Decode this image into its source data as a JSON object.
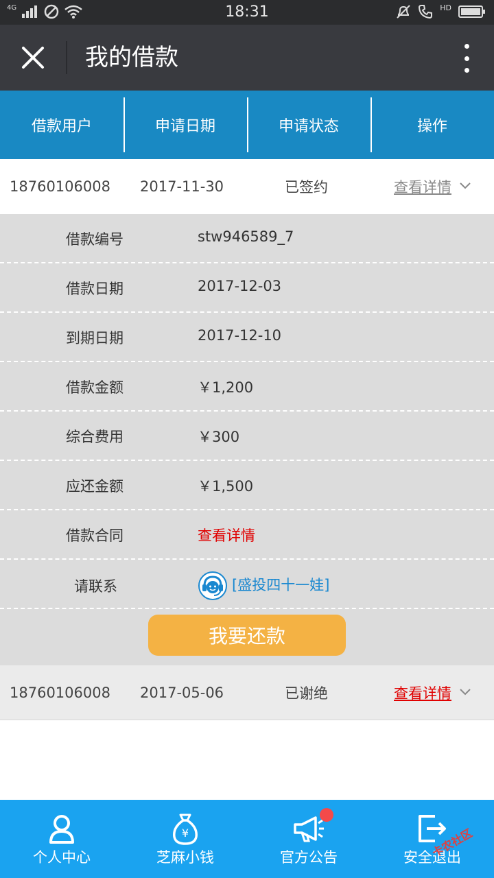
{
  "status_bar": {
    "network": "4G",
    "time": "18:31",
    "hd": "HD"
  },
  "title_bar": {
    "title": "我的借款"
  },
  "table_header": [
    "借款用户",
    "申请日期",
    "申请状态",
    "操作"
  ],
  "loans": [
    {
      "user": "18760106008",
      "date": "2017-11-30",
      "status": "已签约",
      "action": "查看详情"
    },
    {
      "user": "18760106008",
      "date": "2017-05-06",
      "status": "已谢绝",
      "action": "查看详情"
    }
  ],
  "details": {
    "loan_no": {
      "label": "借款编号",
      "value": "stw946589_7"
    },
    "loan_date": {
      "label": "借款日期",
      "value": "2017-12-03"
    },
    "due_date": {
      "label": "到期日期",
      "value": "2017-12-10"
    },
    "amount": {
      "label": "借款金额",
      "value": "￥1,200"
    },
    "fee": {
      "label": "综合费用",
      "value": "￥300"
    },
    "repay_amount": {
      "label": "应还金额",
      "value": "￥1,500"
    },
    "contract": {
      "label": "借款合同",
      "value": "查看详情"
    },
    "contact": {
      "label": "请联系",
      "value": "[盛投四十一娃]"
    },
    "repay_button": "我要还款"
  },
  "bottom_nav": [
    {
      "label": "个人中心",
      "icon": "person-icon"
    },
    {
      "label": "芝麻小钱",
      "icon": "money-bag-icon"
    },
    {
      "label": "官方公告",
      "icon": "megaphone-icon"
    },
    {
      "label": "安全退出",
      "icon": "logout-icon"
    }
  ],
  "watermark": "卡农社区",
  "colors": {
    "header_blue": "#1989c3",
    "nav_blue": "#1aa3f0",
    "repay_orange": "#f4b244",
    "link_red": "#e00000",
    "link_blue": "#1a88d0"
  }
}
